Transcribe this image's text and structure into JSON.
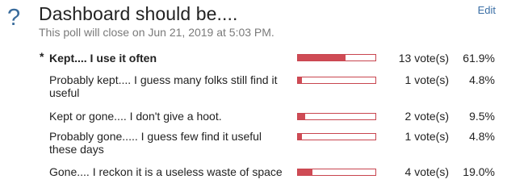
{
  "poll": {
    "icon": "?",
    "title": "Dashboard should be....",
    "subtitle": "This poll will close on Jun 21, 2019 at 5:03 PM.",
    "edit_label": "Edit",
    "voted_marker": "*",
    "colors": {
      "bar": "#cf4b55",
      "bar_border": "#c8454f",
      "accent": "#3a6c9c"
    },
    "options": [
      {
        "label": "Kept.... I use it often",
        "votes": "13 vote(s)",
        "percent": "61.9%",
        "fraction": 0.619,
        "voted": true
      },
      {
        "label": "Probably kept.... I guess many folks still find it useful",
        "votes": "1 vote(s)",
        "percent": "4.8%",
        "fraction": 0.048,
        "voted": false
      },
      {
        "label": "Kept or gone.... I don't give a hoot.",
        "votes": "2 vote(s)",
        "percent": "9.5%",
        "fraction": 0.095,
        "voted": false
      },
      {
        "label": "Probably gone..... I guess few find it useful these days",
        "votes": "1 vote(s)",
        "percent": "4.8%",
        "fraction": 0.048,
        "voted": false
      },
      {
        "label": "Gone.... I reckon it is a useless waste of space",
        "votes": "4 vote(s)",
        "percent": "19.0%",
        "fraction": 0.19,
        "voted": false
      }
    ]
  }
}
